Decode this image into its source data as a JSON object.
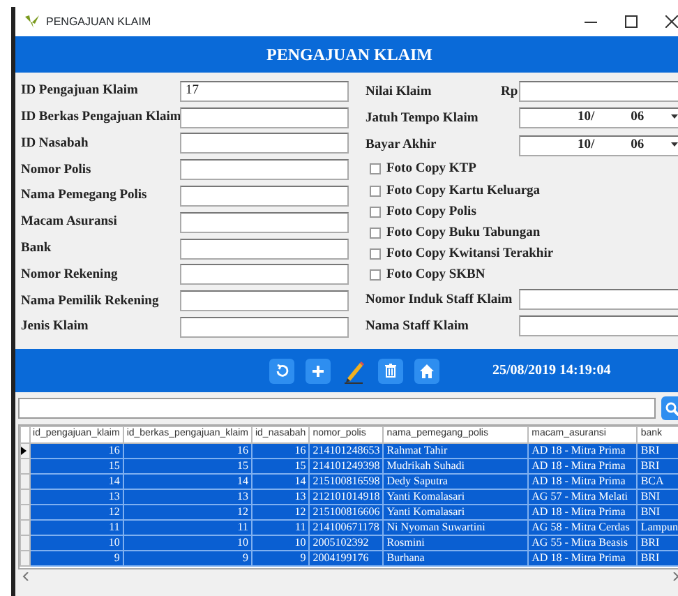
{
  "window": {
    "title": "PENGAJUAN KLAIM"
  },
  "header": {
    "title": "PENGAJUAN KLAIM"
  },
  "left_fields": [
    {
      "label": "ID Pengajuan Klaim",
      "value": "17"
    },
    {
      "label": "ID Berkas Pengajuan Klaim"
    },
    {
      "label": "ID Nasabah"
    },
    {
      "label": "Nomor Polis"
    },
    {
      "label": "Nama Pemegang Polis"
    },
    {
      "label": "Macam Asuransi"
    },
    {
      "label": "Bank"
    },
    {
      "label": "Nomor Rekening"
    },
    {
      "label": "Nama Pemilik Rekening"
    },
    {
      "label": "Jenis Klaim"
    }
  ],
  "right_fields": [
    {
      "kind": "money",
      "label": "Nilai Klaim",
      "prefix": "Rp"
    },
    {
      "kind": "date",
      "label": "Jatuh Tempo Klaim",
      "day": "10/",
      "month": "06"
    },
    {
      "kind": "date",
      "label": "Bayar Akhir",
      "day": "10/",
      "month": "06"
    },
    {
      "kind": "checkbox",
      "label": "Foto Copy KTP",
      "checked": false
    },
    {
      "kind": "checkbox",
      "label": "Foto Copy Kartu Keluarga",
      "checked": false
    },
    {
      "kind": "checkbox",
      "label": "Foto Copy Polis",
      "checked": false
    },
    {
      "kind": "checkbox",
      "label": "Foto Copy Buku Tabungan",
      "checked": false
    },
    {
      "kind": "checkbox",
      "label": "Foto Copy Kwitansi Terakhir",
      "checked": false
    },
    {
      "kind": "checkbox",
      "label": "Foto Copy SKBN",
      "checked": false
    },
    {
      "kind": "text",
      "label": "Nomor Induk Staff Klaim"
    },
    {
      "kind": "text",
      "label": "Nama Staff Klaim"
    }
  ],
  "toolbar": {
    "datetime": "25/08/2019 14:19:04"
  },
  "table": {
    "columns": [
      "id_pengajuan_klaim",
      "id_berkas_pengajuan_klaim",
      "id_nasabah",
      "nomor_polis",
      "nama_pemegang_polis",
      "macam_asuransi",
      "bank"
    ],
    "rows": [
      {
        "current": true,
        "selected": true,
        "cells": [
          "16",
          "16",
          "16",
          "214101248653",
          "Rahmat Tahir",
          "AD 18 - Mitra Prima",
          "BRI"
        ]
      },
      {
        "current": false,
        "selected": true,
        "cells": [
          "15",
          "15",
          "15",
          "214101249398",
          "Mudrikah Suhadi",
          "AD 18 - Mitra Prima",
          "BRI"
        ]
      },
      {
        "current": false,
        "selected": true,
        "cells": [
          "14",
          "14",
          "14",
          "215100816598",
          "Dedy Saputra",
          "AD 18 - Mitra Prima",
          "BCA"
        ]
      },
      {
        "current": false,
        "selected": true,
        "cells": [
          "13",
          "13",
          "13",
          "212101014918",
          "Yanti Komalasari",
          "AG 57 - Mitra Melati",
          "BNI"
        ]
      },
      {
        "current": false,
        "selected": true,
        "cells": [
          "12",
          "12",
          "12",
          "215100816606",
          "Yanti Komalasari",
          "AD 18 - Mitra Prima",
          "BNI"
        ]
      },
      {
        "current": false,
        "selected": true,
        "cells": [
          "11",
          "11",
          "11",
          "214100671178",
          "Ni Nyoman Suwartini",
          "AG 58 - Mitra Cerdas",
          "Lampun"
        ]
      },
      {
        "current": false,
        "selected": true,
        "cells": [
          "10",
          "10",
          "10",
          "2005102392",
          "Rosmini",
          "AG 55 - Mitra Beasis",
          "BRI"
        ]
      },
      {
        "current": false,
        "selected": true,
        "cells": [
          "9",
          "9",
          "9",
          "2004199176",
          "Burhana",
          "AD 18 - Mitra Prima",
          "BRI"
        ]
      }
    ]
  }
}
